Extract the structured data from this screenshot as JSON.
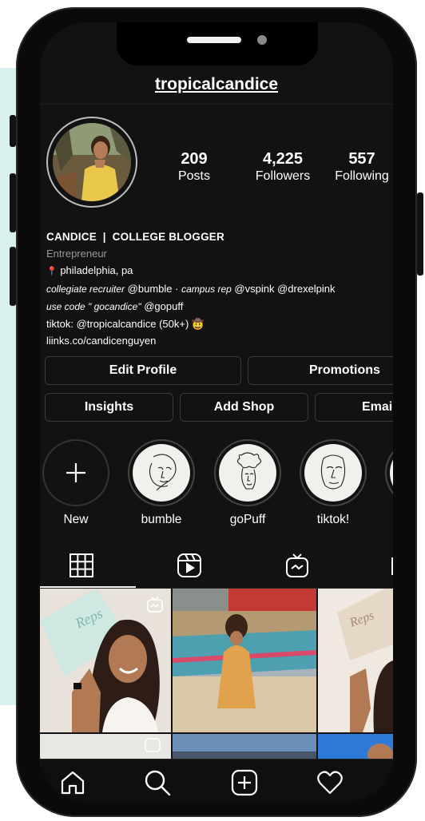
{
  "profile": {
    "username": "tropicalcandice",
    "stats": [
      {
        "value": "209",
        "label": "Posts"
      },
      {
        "value": "4,225",
        "label": "Followers"
      },
      {
        "value": "557",
        "label": "Following"
      }
    ],
    "name": "CANDICE  |  COLLEGE BLOGGER",
    "category": "Entrepreneur",
    "location": "philadelphia, pa",
    "line_recruiter_em": "collegiate recruiter",
    "line_recruiter_handle": "@bumble",
    "line_rep_em": "campus rep",
    "line_rep_handles": "@vspink @drexelpink",
    "line_code_em": "use code \" gocandice\"",
    "line_code_handle": "@gopuff",
    "tiktok_line": "tiktok: @tropicalcandice (50k+) 🤠",
    "link": "liinks.co/candicenguyen"
  },
  "buttons": {
    "edit_profile": "Edit Profile",
    "promotions": "Promotions",
    "insights": "Insights",
    "add_shop": "Add Shop",
    "email": "Email"
  },
  "highlights": [
    {
      "label": "New"
    },
    {
      "label": "bumble"
    },
    {
      "label": "goPuff"
    },
    {
      "label": "tiktok!"
    }
  ],
  "tabs": [
    "grid-icon",
    "reels-icon",
    "igtv-icon",
    "tagged-icon"
  ],
  "nav": [
    "home-icon",
    "search-icon",
    "new-post-icon",
    "heart-icon"
  ],
  "colors": {
    "background": "#121212",
    "text": "#ffffff",
    "secondary_text": "#9a9a9a",
    "accent_panel": "#d9f1ee"
  }
}
